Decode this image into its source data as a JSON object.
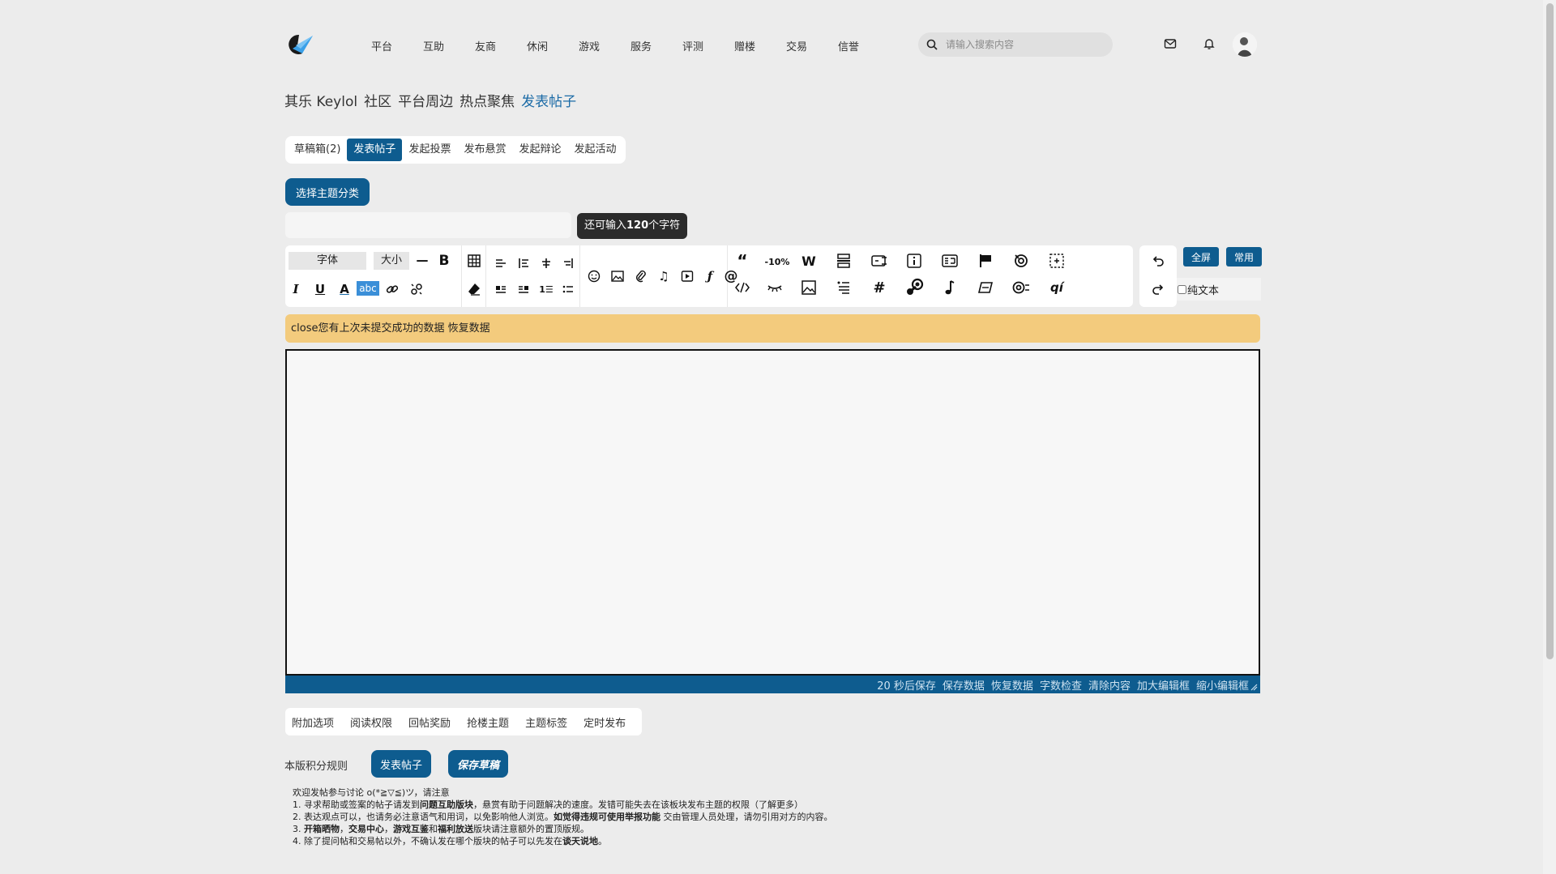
{
  "header": {
    "nav": [
      "平台",
      "互助",
      "友商",
      "休闲",
      "游戏",
      "服务",
      "评测",
      "赠楼",
      "交易",
      "信誉"
    ],
    "search_placeholder": "请输入搜索内容"
  },
  "breadcrumb": [
    "其乐 Keylol",
    "社区",
    "平台周边",
    "热点聚焦",
    "发表帖子"
  ],
  "tabs": [
    "草稿箱(2)",
    "发表帖子",
    "发起投票",
    "发布悬赏",
    "发起辩论",
    "发起活动"
  ],
  "category_button": "选择主题分类",
  "char_tip": {
    "prefix": "还可输入",
    "count": "120",
    "suffix": "个字符"
  },
  "toolbar": {
    "font_label": "字体",
    "size_label": "大小",
    "fullscreen": "全屏",
    "common": "常用",
    "plain_text": "纯文本"
  },
  "notice": {
    "close": "close",
    "message": "您有上次未提交成功的数据",
    "restore": "恢复数据"
  },
  "statusbar": [
    "20 秒后保存",
    "保存数据",
    "恢复数据",
    "字数检查",
    "清除内容",
    "加大编辑框",
    "缩小编辑框"
  ],
  "options": [
    "附加选项",
    "阅读权限",
    "回帖奖励",
    "抢楼主题",
    "主题标签",
    "定时发布"
  ],
  "footer": {
    "rules": "本版积分规则",
    "post_button": "发表帖子",
    "draft_button": "保存草稿"
  },
  "help": {
    "intro": "欢迎发帖参与讨论 o(*≧▽≦)ツ，请注意",
    "l1a": "1. 寻求帮助或签案的帖子请发到",
    "l1b": "问题互助版块",
    "l1c": "，悬赏有助于问题解决的速度。发错可能失去在该板块发布主题的权限（了解更多）",
    "l2a": "2. 表达观点可以，也请务必注意语气和用词，以免影响他人浏览。",
    "l2b": "如觉得违规可使用举报功能",
    "l2c": " 交由管理人员处理，请勿引用对方的内容。",
    "l3a": "3. ",
    "l3b": "开箱晒物",
    "l3c": "，",
    "l3d": "交易中心",
    "l3e": "，",
    "l3f": "游戏互鉴",
    "l3g": "和",
    "l3h": "福利放送",
    "l3i": "版块请注意额外的置顶版规。",
    "l4a": "4. 除了提问帖和交易帖以外，不确认发在哪个版块的帖子可以先发在",
    "l4b": "谈天说地",
    "l4c": "。"
  },
  "colors": {
    "accent": "#0e5c8f",
    "notice": "#f3cb7d",
    "tooltip": "#2b2b2b"
  }
}
